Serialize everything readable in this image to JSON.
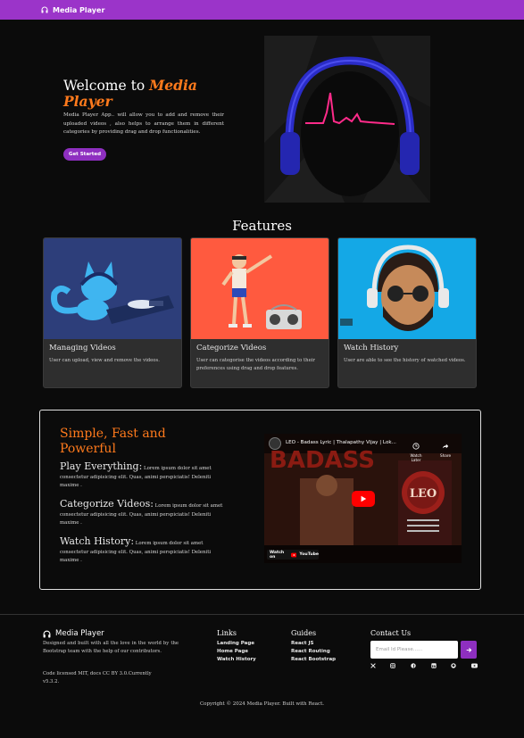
{
  "navbar": {
    "brand": "Media Player",
    "icon": "headphones-icon"
  },
  "hero": {
    "title_prefix": "Welcome to ",
    "title_accent": "Media Player",
    "description": "Media Player App.. will allow you to add and remove their uploaded videos , also helps to arrange them in different categories by providing drag and drop functionalities.",
    "button": "Get Started"
  },
  "features": {
    "title": "Features",
    "cards": [
      {
        "title": "Managing Videos",
        "text": "User can upload, view and remove the videos."
      },
      {
        "title": "Categorize Videos",
        "text": "User can categorise the videos according to their preferences using drag and drop features."
      },
      {
        "title": "Watch History",
        "text": "User are able to see the history of watched videos."
      }
    ]
  },
  "simple": {
    "title": "Simple, Fast and Powerful",
    "items": [
      {
        "heading": "Play Everything:",
        "text": "Lorem ipsum dolor sit amet consectetur adipisicing elit. Quas, animi perspiciatis! Deleniti maxime ."
      },
      {
        "heading": "Categorize Videos:",
        "text": "Lorem ipsum dolor sit amet consectetur adipisicing elit. Quas, animi perspiciatis! Deleniti maxime ."
      },
      {
        "heading": "Watch History:",
        "text": "Lorem ipsum dolor sit amet consectetur adipisicing elit. Quas, animi perspiciatis! Deleniti maxime ."
      }
    ]
  },
  "video": {
    "title": "LEO - Badass Lyric | Thalapathy Vijay | Lok...",
    "watch_later": "Watch Later",
    "share": "Share",
    "watch_on": "Watch on",
    "platform": "YouTube",
    "poster_big": "BADASS",
    "poster_leo": "LEO"
  },
  "footer": {
    "brand": "Media Player",
    "description": "Designed and built with all the love in the world by the Bootstrap team with the help of our contributors.",
    "license": "Code licensed MIT, docs CC BY 3.0.Currently v5.3.2.",
    "links_heading": "Links",
    "links": [
      "Landing Page",
      "Home Page",
      "Watch History"
    ],
    "guides_heading": "Guides",
    "guides": [
      "React JS",
      "React Routing",
      "React Bootstrap"
    ],
    "contact_heading": "Contact Us",
    "email_placeholder": "Email Id Please......",
    "social_icons": [
      "x-icon",
      "instagram-icon",
      "facebook-icon",
      "linkedin-icon",
      "github-icon",
      "youtube-icon"
    ],
    "copyright": "Copyright © 2024 Media Player. Built with React."
  },
  "colors": {
    "accent": "#ff7a1c",
    "primary": "#9b34c9",
    "background": "#0b0b0b"
  }
}
